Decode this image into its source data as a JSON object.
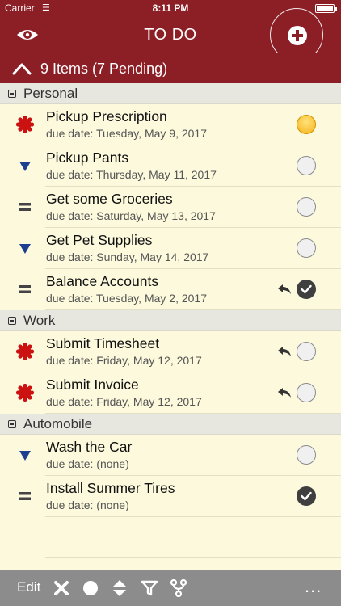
{
  "status_bar": {
    "carrier": "Carrier",
    "time": "8:11 PM"
  },
  "nav": {
    "title": "TO DO"
  },
  "summary": {
    "text": "9 Items (7 Pending)"
  },
  "sections": [
    {
      "label": "Personal",
      "items": [
        {
          "title": "Pickup Prescription",
          "due": "due date: Tuesday, May 9, 2017",
          "priority": "high",
          "state": "pending",
          "undo": false
        },
        {
          "title": "Pickup Pants",
          "due": "due date: Thursday, May 11, 2017",
          "priority": "low",
          "state": "open",
          "undo": false
        },
        {
          "title": "Get some Groceries",
          "due": "due date: Saturday, May 13, 2017",
          "priority": "normal",
          "state": "open",
          "undo": false
        },
        {
          "title": "Get Pet Supplies",
          "due": "due date: Sunday, May 14, 2017",
          "priority": "low",
          "state": "open",
          "undo": false
        },
        {
          "title": "Balance Accounts",
          "due": "due date: Tuesday, May 2, 2017",
          "priority": "normal",
          "state": "done",
          "undo": true
        }
      ]
    },
    {
      "label": "Work",
      "items": [
        {
          "title": "Submit Timesheet",
          "due": "due date: Friday, May 12, 2017",
          "priority": "high",
          "state": "open",
          "undo": true
        },
        {
          "title": "Submit Invoice",
          "due": "due date: Friday, May 12, 2017",
          "priority": "high",
          "state": "open",
          "undo": true
        }
      ]
    },
    {
      "label": "Automobile",
      "items": [
        {
          "title": "Wash the Car",
          "due": "due date: (none)",
          "priority": "low",
          "state": "open",
          "undo": false
        },
        {
          "title": "Install Summer Tires",
          "due": "due date: (none)",
          "priority": "normal",
          "state": "done",
          "undo": false
        }
      ]
    }
  ],
  "toolbar": {
    "edit_label": "Edit",
    "more_label": "..."
  },
  "colors": {
    "brand": "#8c1f26",
    "background": "#fdf9dc",
    "toolbar": "#8c8c8c",
    "high_priority": "#cc1111",
    "low_priority": "#1c3f8f"
  }
}
